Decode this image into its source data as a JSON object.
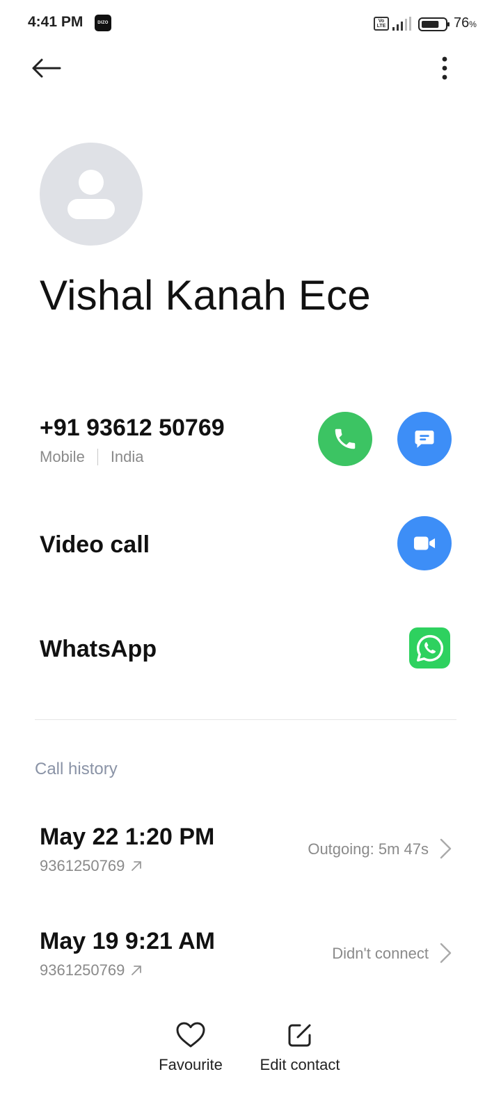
{
  "status_bar": {
    "time": "4:41 PM",
    "app_badge": "DIZO",
    "network": "Vo LTE",
    "battery_percent": "76",
    "battery_unit": "%",
    "battery_level": 0.76
  },
  "app_bar": {
    "back_icon": "arrow-left-icon",
    "more_icon": "more-vert-icon"
  },
  "contact": {
    "avatar_icon": "person-icon",
    "name": "Vishal Kanah Ece"
  },
  "phone": {
    "number": "+91 93612 50769",
    "type": "Mobile",
    "region": "India",
    "call_icon": "phone-icon",
    "message_icon": "message-icon"
  },
  "video_call": {
    "label": "Video call",
    "icon": "video-camera-icon"
  },
  "whatsapp": {
    "label": "WhatsApp",
    "icon": "whatsapp-icon"
  },
  "call_history": {
    "title": "Call history",
    "items": [
      {
        "date": "May 22 1:20 PM",
        "number": "9361250769",
        "status": "Outgoing: 5m 47s"
      },
      {
        "date": "May 19 9:21 AM",
        "number": "9361250769",
        "status": "Didn't connect"
      }
    ]
  },
  "bottom_bar": {
    "favourite_label": "Favourite",
    "edit_label": "Edit contact"
  },
  "colors": {
    "call_green": "#3cc463",
    "action_blue": "#3d8ef7",
    "whatsapp_green": "#2ed15f",
    "avatar_bg": "#dfe1e6",
    "section_title": "#8a93a6"
  }
}
